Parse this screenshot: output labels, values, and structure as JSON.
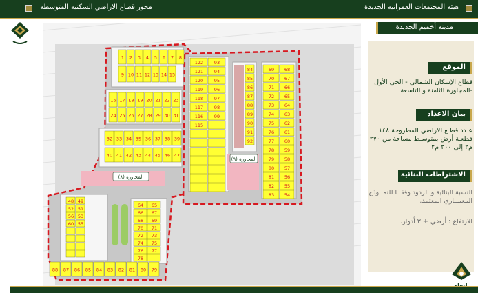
{
  "header": {
    "left_title": "محور قطاع الاراضي السكنية المتوسطة",
    "right_title": "هيئة المجتمعات العمرانية الجديدة"
  },
  "panel": {
    "city_name": "مدينة أخميم الجديدة",
    "location_heading": "الموقع",
    "location_text": "قطاع الإسكان الشمالي - الحي الأول -المجاورة الثامنة و التاسعة",
    "counts_heading": "بيان الاعداد",
    "counts_text": "عـدد قطـع الاراضي المطروحة ١٤٨ قطعـة أرض بمتوسـط مساحة من ٢٧٠ م٢ إلي ٣٠٠ م٢",
    "conditions_heading": "الاشتراطات البنائية",
    "conditions_text": "النسبة البنائية و الردود وفقــا للنمــوذج المعمــاري المعتمد.",
    "height_text": "الارتفاع : أرضي + ٣ أدوار.",
    "brand_text": "اتجاه الشمال"
  },
  "map": {
    "neighborhood_8_label": "المجاورة (٨)",
    "neighborhood_9_label": "المجاورة (٩)",
    "block_a_row1": [
      "1",
      "2",
      "3",
      "4",
      "5",
      "6",
      "7",
      "8"
    ],
    "block_a_row2": [
      "9",
      "10",
      "11",
      "12",
      "13",
      "14",
      "15"
    ],
    "block_b_row1": [
      "16",
      "17",
      "18",
      "19",
      "20",
      "21",
      "22",
      "23"
    ],
    "block_b_row2": [
      "24",
      "25",
      "26",
      "27",
      "28",
      "29",
      "30",
      "31"
    ],
    "block_c_row1": [
      "32",
      "33",
      "34",
      "35",
      "36",
      "37",
      "38",
      "39"
    ],
    "block_c_row2": [
      "40",
      "41",
      "42",
      "43",
      "44",
      "45",
      "46",
      "47"
    ],
    "col_a": [
      "122",
      "121",
      "120",
      "119",
      "118",
      "117",
      "116",
      "115",
      "114",
      "113",
      "112",
      "111",
      "110",
      "109",
      "108"
    ],
    "col_b": [
      "93",
      "94",
      "95",
      "96",
      "97",
      "98",
      "99",
      "100",
      "101",
      "102",
      "103",
      "104",
      "105",
      "106",
      "107"
    ],
    "col_c": [
      "84",
      "85",
      "86",
      "87",
      "88",
      "89",
      "90",
      "91",
      "92"
    ],
    "col_d": [
      "69",
      "70",
      "71",
      "72",
      "73",
      "74",
      "75",
      "76",
      "77",
      "78",
      "79",
      "80",
      "81",
      "82",
      "83"
    ],
    "col_e": [
      "68",
      "67",
      "66",
      "65",
      "64",
      "63",
      "62",
      "61",
      "60",
      "59",
      "58",
      "57",
      "56",
      "55",
      "54"
    ],
    "lower_left_left": [
      "48",
      "50",
      "52",
      "54",
      "56",
      "58",
      "60",
      "62"
    ],
    "lower_left_right": [
      "49",
      "51",
      "53",
      "55",
      "57",
      "59",
      "61",
      "63"
    ],
    "lower_mid_right": [
      "64",
      "65",
      "66",
      "67",
      "68",
      "69",
      "70",
      "71",
      "72",
      "73",
      "74",
      "75",
      "76",
      "77",
      "78"
    ],
    "bottom_row": [
      "88",
      "87",
      "86",
      "85",
      "84",
      "83",
      "82",
      "81",
      "80",
      "79"
    ]
  },
  "colors": {
    "dark_green": "#173f1e",
    "gold": "#c9a84c",
    "plot_yellow": "#ffff33",
    "road_grey": "#a7a7a7",
    "boundary_red": "#d71920",
    "pink": "#f2b6c1",
    "beige": "#f0ead9"
  }
}
